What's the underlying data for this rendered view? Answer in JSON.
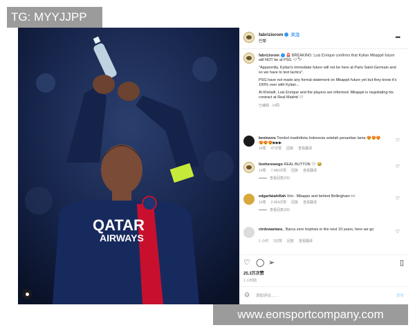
{
  "overlay": {
    "tg_label": "TG: MYYJJPP",
    "watermark": "www.eonsportcompany.com"
  },
  "photo": {
    "jersey_sponsor": "QATAR",
    "jersey_sponsor_sub": "AIRWAYS"
  },
  "post": {
    "username": "fabriziorom",
    "follow_label": "关注",
    "location": "巴黎",
    "caption": {
      "username": "fabriziorom",
      "line1": "🚨 BREAKING: Luis Enrique confirms that Kylian Mbappé future will NOT be at PSG 🤍🔭",
      "line2": "\"Apparently, Kylian's immediate future will not be here at Paris Saint-Germain and so we have to test tactics\".",
      "line3": "PSG have not made any formal statement on Mbappé future yet but they know it's 100% over with Kylian...",
      "line4": "Al Khelaifi, Luis Enrique and the players are informed. Mbappé is negotiating his contract at Real Madrid 🤍",
      "time": "已编辑 · 14周"
    },
    "comments": [
      {
        "username": "kevinzzrs",
        "text": "Tombol madridista Indonesia setelah penantian lama 😍😍😍😍😍😍▶▶▶",
        "time": "14周",
        "likes": "47次赞",
        "reply": "回复",
        "translate": "查看翻译",
        "replies": ""
      },
      {
        "username": "liveherewego",
        "text": "REAL BUTTON 🤍 😂",
        "time": "14周",
        "likes": "7,460次赞",
        "reply": "回复",
        "translate": "查看翻译",
        "replies": "查看回复(26)"
      },
      {
        "username": "edgarfatahillah",
        "text": "Vini - Mbappe and behind Bellingham 👀",
        "time": "14周",
        "likes": "2,454次赞",
        "reply": "回复",
        "translate": "查看翻译",
        "replies": "查看回复(39)"
      },
      {
        "username": "ctrdewantara_",
        "text": "Barca zero trophies in the next 10 years, here we go",
        "time": "1 小时",
        "likes": "3次赞",
        "reply": "回复",
        "translate": "查看翻译",
        "replies": ""
      }
    ],
    "likes_count": "25.3万次赞",
    "time_ago": "1 小时前",
    "add_comment_placeholder": "添加评论……",
    "post_label": "发布"
  },
  "colors": {
    "accent": "#3897f0",
    "overlay_bg": "#9b9b9b"
  }
}
